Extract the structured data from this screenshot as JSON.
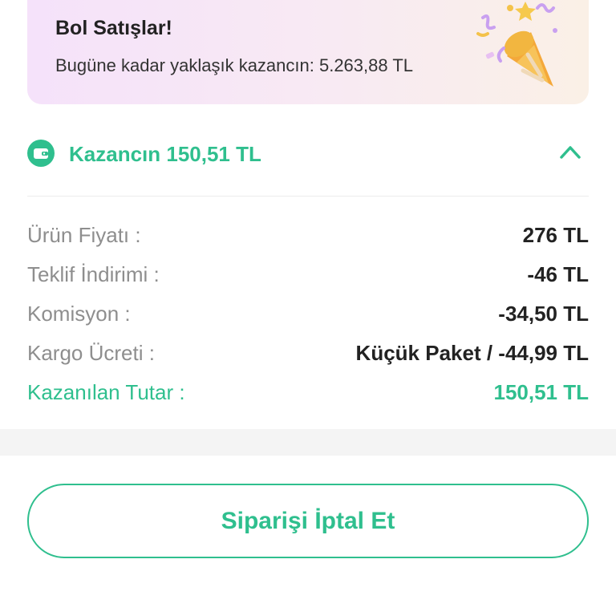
{
  "banner": {
    "title": "Bol Satışlar!",
    "subtitle": "Bugüne kadar yaklaşık kazancın: 5.263,88 TL"
  },
  "earnings": {
    "title": "Kazancın 150,51 TL"
  },
  "breakdown": {
    "rows": [
      {
        "label": "Ürün Fiyatı :",
        "value": "276 TL"
      },
      {
        "label": "Teklif İndirimi :",
        "value": "-46 TL"
      },
      {
        "label": "Komisyon :",
        "value": "-34,50 TL"
      },
      {
        "label": "Kargo Ücreti :",
        "value": "Küçük Paket / -44,99 TL"
      },
      {
        "label": "Kazanılan Tutar :",
        "value": "150,51 TL"
      }
    ]
  },
  "actions": {
    "cancel_label": "Siparişi İptal Et"
  },
  "colors": {
    "accent": "#2fbf8e",
    "banner_start": "#f5e2fa",
    "banner_end": "#faf0e6"
  },
  "icons": {
    "banner": "party-popper-icon",
    "earnings": "wallet-icon",
    "toggle": "chevron-up-icon"
  }
}
